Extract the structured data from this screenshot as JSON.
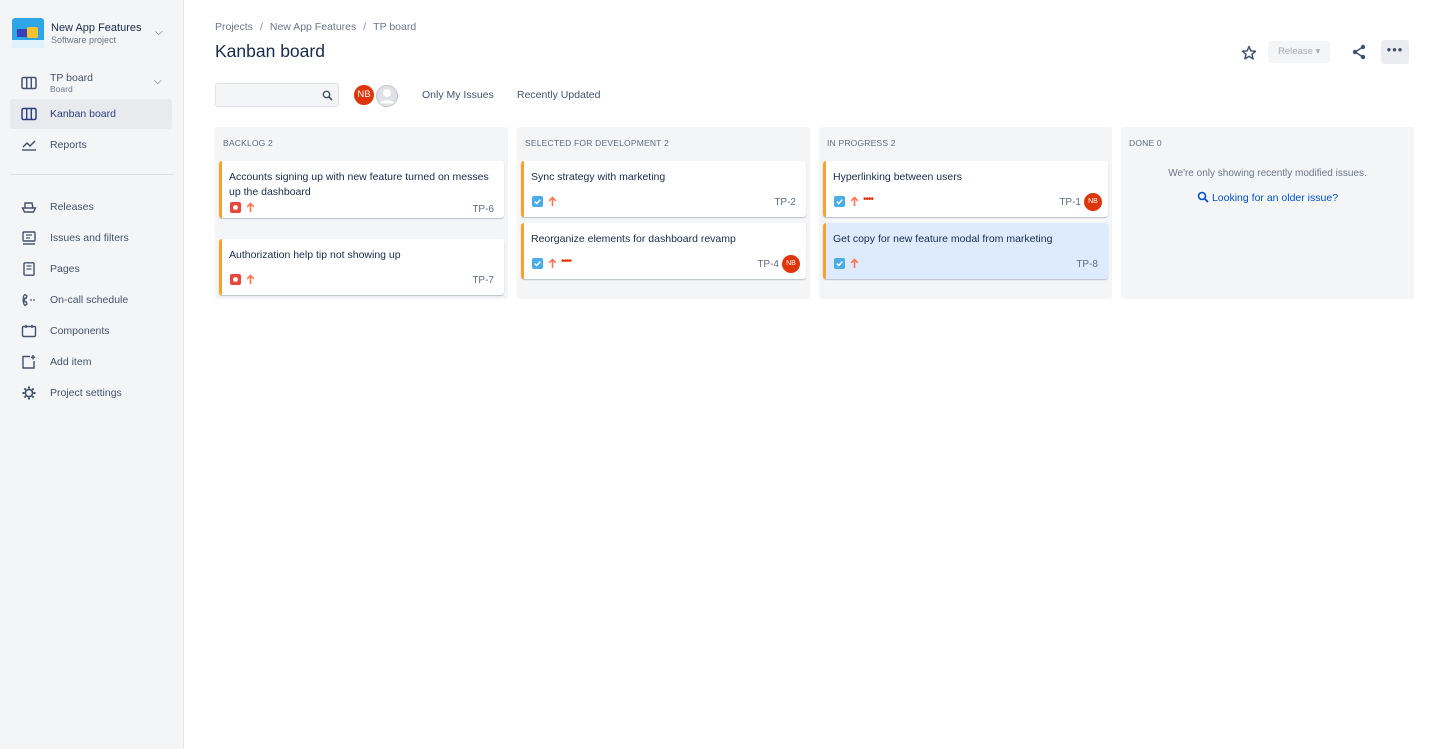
{
  "sidebar": {
    "project_name": "New App Features",
    "project_type": "Software project",
    "board": {
      "label": "TP board",
      "sub": "Board"
    },
    "items": [
      {
        "label": "Kanban board",
        "icon": "kanban-icon",
        "active": true
      },
      {
        "label": "Reports",
        "icon": "chart-icon"
      },
      {
        "label": "Releases",
        "icon": "ship-icon"
      },
      {
        "label": "Issues and filters",
        "icon": "issues-icon"
      },
      {
        "label": "Pages",
        "icon": "page-icon"
      },
      {
        "label": "On-call schedule",
        "icon": "phone-icon"
      },
      {
        "label": "Components",
        "icon": "component-icon"
      },
      {
        "label": "Add item",
        "icon": "add-item-icon"
      },
      {
        "label": "Project settings",
        "icon": "gear-icon"
      }
    ]
  },
  "header": {
    "breadcrumbs": [
      "Projects",
      "New App Features",
      "TP board"
    ],
    "title": "Kanban board",
    "release_label": "Release"
  },
  "filters": {
    "search_placeholder": "",
    "avatar_initials": "NB",
    "only_my_issues": "Only My Issues",
    "recently_updated": "Recently Updated"
  },
  "columns": [
    {
      "title": "Backlog 2",
      "cards": [
        {
          "title": "Accounts signing up with new feature turned on messes up the dashboard",
          "key": "TP-6",
          "type": "bug",
          "priority": "high"
        },
        {
          "title": "Authorization help tip not showing up",
          "key": "TP-7",
          "type": "bug",
          "priority": "high"
        }
      ]
    },
    {
      "title": "Selected for Development 2",
      "cards": [
        {
          "title": "Sync strategy with marketing",
          "key": "TP-2",
          "type": "task",
          "priority": "high"
        },
        {
          "title": "Reorganize elements for dashboard revamp",
          "key": "TP-4",
          "type": "task",
          "priority": "high",
          "flag": "••••",
          "assignee": "NB"
        }
      ]
    },
    {
      "title": "In Progress 2",
      "cards": [
        {
          "title": "Hyperlinking between users",
          "key": "TP-1",
          "type": "task",
          "priority": "high",
          "flag": "••••",
          "assignee": "NB"
        },
        {
          "title": "Get copy for new feature modal from marketing",
          "key": "TP-8",
          "type": "task",
          "priority": "high",
          "selected": true
        }
      ]
    },
    {
      "title": "Done 0",
      "empty_message": "We're only showing recently modified issues.",
      "empty_link": "Looking for an older issue?"
    }
  ],
  "colors": {
    "accent": "#0052cc",
    "bug": "#e5493a",
    "task": "#4bade8",
    "priority_high": "#ff7452",
    "avatar": "#de350b",
    "card_stripe": "#f6a32e"
  }
}
